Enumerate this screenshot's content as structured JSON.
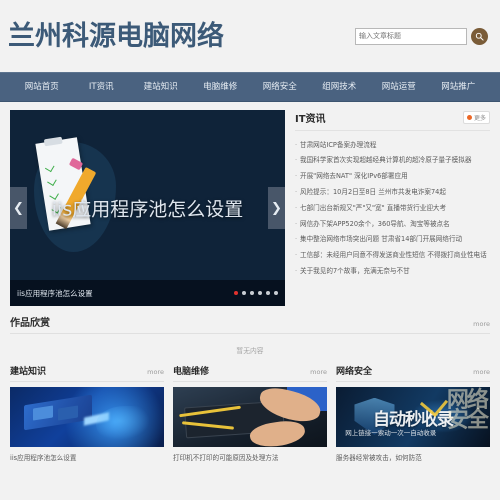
{
  "header": {
    "logo": "兰州科源电脑网络",
    "search": {
      "placeholder": "输入文章标题",
      "value": "",
      "button_icon": "search-icon"
    }
  },
  "nav": {
    "items": [
      {
        "label": "网站首页"
      },
      {
        "label": "IT资讯"
      },
      {
        "label": "建站知识"
      },
      {
        "label": "电脑维修"
      },
      {
        "label": "网络安全"
      },
      {
        "label": "组网技术"
      },
      {
        "label": "网站运营"
      },
      {
        "label": "网站推广"
      }
    ]
  },
  "carousel": {
    "slide_title": "iis应用程序池怎么设置",
    "caption": "iis应用程序池怎么设置",
    "prev_icon": "chevron-left-icon",
    "next_icon": "chevron-right-icon",
    "dots_total": 6,
    "dot_active_index": 0,
    "active_dot_color": "#e0322e"
  },
  "news": {
    "title": "IT资讯",
    "more_label": "更多",
    "more_dot_color": "#ec6726",
    "items": [
      "甘肃网站ICP备案办理流程",
      "我国科学家首次实现超越经典计算机的超冷原子量子模拟器",
      "开展\"网络去NAT\" 深化IPv6部署应用",
      "风险提示：10月2日至8日 兰州市共发电诈案74起",
      "七部门出台新规又\"严\"又\"宽\" 直播带货行业迎大考",
      "网信办下架APP520余个，360导航、淘宝等被点名",
      "集中整治网络市场突出问题 甘肃省14部门开展网络行动",
      "工信部：未经用户同意不得发送商业性短信 不得拨打商业性电话",
      "关于我见的7个故事，充满无奈与不甘"
    ]
  },
  "works": {
    "title": "作品欣赏",
    "more_label": "more",
    "empty_text": "暂无内容"
  },
  "columns": [
    {
      "title": "建站知识",
      "more_label": "more",
      "thumb_name": "building-knowledge-thumbnail",
      "caption": "iis应用程序池怎么设置"
    },
    {
      "title": "电脑维修",
      "more_label": "more",
      "thumb_name": "computer-repair-thumbnail",
      "caption": "打印机不打印的可能原因及处理方法"
    },
    {
      "title": "网络安全",
      "more_label": "more",
      "thumb_name": "network-security-thumbnail",
      "caption": "服务器经常被攻击，如何防范",
      "watermark": {
        "main": "自动秒收录",
        "sub": "网上链接一索动一次一自动收录",
        "big": "网络\n交全"
      }
    }
  ],
  "theme": {
    "nav_bg": "#4a6280",
    "logo_color": "#3c5a78",
    "search_btn": "#7a5c38",
    "page_bg": "#f2f2f2"
  }
}
